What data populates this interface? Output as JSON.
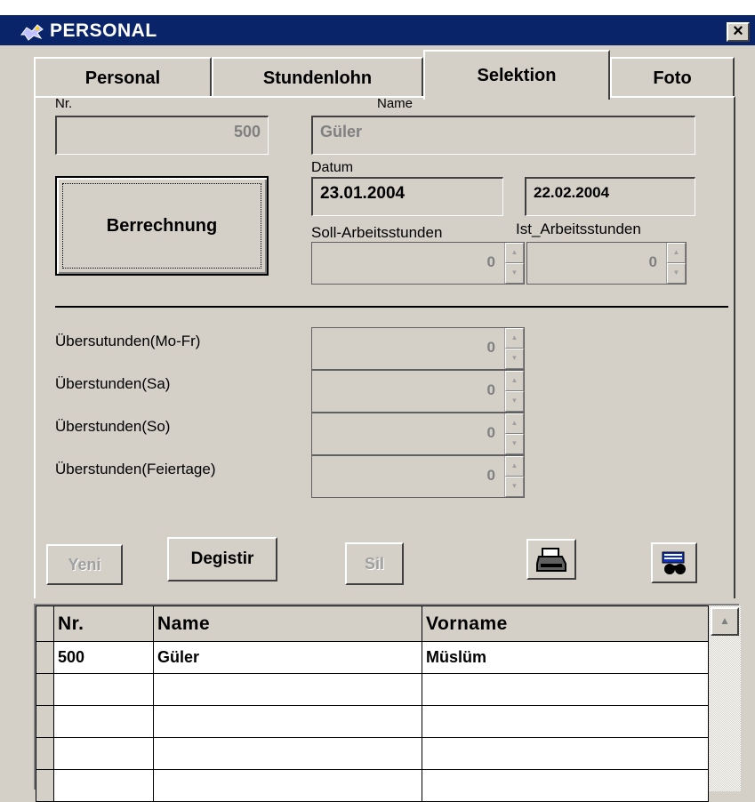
{
  "window": {
    "title": "PERSONAL",
    "close_label": "×"
  },
  "tabs": [
    {
      "label": "Personal",
      "active": false
    },
    {
      "label": "Stundenlohn",
      "active": false
    },
    {
      "label": "Selektion",
      "active": true
    },
    {
      "label": "Foto",
      "active": false
    }
  ],
  "form": {
    "nr_label": "Nr.",
    "nr_value": "500",
    "name_label": "Name",
    "name_value": "Güler",
    "datum_label": "Datum",
    "date_from": "23.01.2004",
    "date_to": "22.02.2004",
    "berechnung_label": "Berrechnung",
    "soll_label": "Soll-Arbeitsstunden",
    "soll_value": "0",
    "ist_label": "Ist_Arbeitsstunden",
    "ist_value": "0",
    "overtime": [
      {
        "label": "Übersutunden(Mo-Fr)",
        "value": "0"
      },
      {
        "label": "Überstunden(Sa)",
        "value": "0"
      },
      {
        "label": "Überstunden(So)",
        "value": "0"
      },
      {
        "label": "Überstunden(Feiertage)",
        "value": "0"
      }
    ]
  },
  "actions": {
    "yeni": "Yeni",
    "degistir": "Degistir",
    "sil": "Sil",
    "print_icon": "printer-icon",
    "search_icon": "binoculars-icon"
  },
  "grid": {
    "columns": [
      "Nr.",
      "Name",
      "Vorname"
    ],
    "rows": [
      [
        "500",
        "Güler",
        "Müslüm"
      ],
      [
        "",
        "",
        ""
      ],
      [
        "",
        "",
        ""
      ],
      [
        "",
        "",
        ""
      ],
      [
        "",
        "",
        ""
      ]
    ]
  },
  "colors": {
    "titlebar": "#0a246a",
    "face": "#d4d0c8"
  }
}
